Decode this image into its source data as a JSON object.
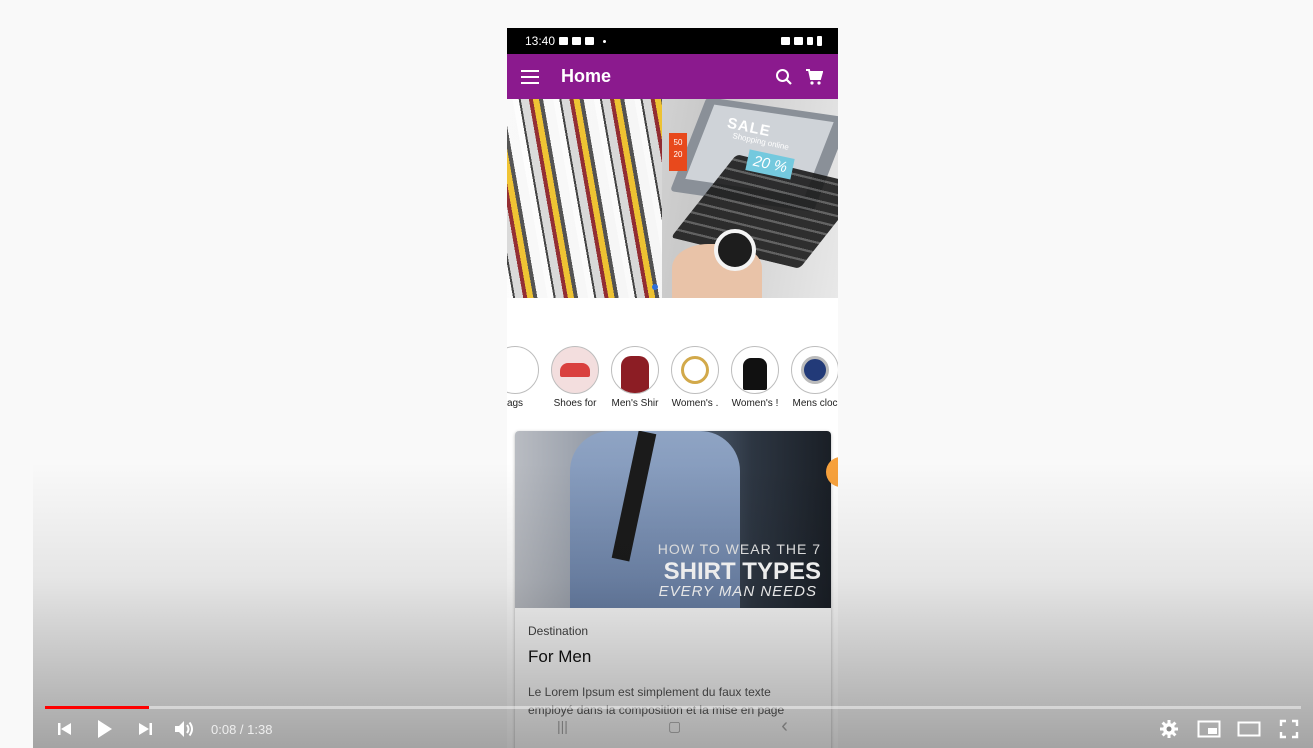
{
  "status_bar": {
    "time": "13:40"
  },
  "app_bar": {
    "title": "Home"
  },
  "banner": {
    "sale": "SALE",
    "sub": "Shopping online",
    "percent": "20 %",
    "tag": "50 20"
  },
  "categories": [
    {
      "label": "ags"
    },
    {
      "label": "Shoes for"
    },
    {
      "label": "Men's Shir"
    },
    {
      "label": "Women's ."
    },
    {
      "label": "Women's !"
    },
    {
      "label": "Mens cloc"
    }
  ],
  "card": {
    "image_line1": "HOW TO WEAR THE 7",
    "image_line2": "SHIRT TYPES",
    "image_line3": "EVERY MAN NEEDS",
    "kicker": "Destination",
    "title": "For Men",
    "description": "Le Lorem Ipsum est simplement du faux texte employé dans la composition et la mise en page"
  },
  "nav_bar": {
    "recents": "|||",
    "home": "▢",
    "back": "‹"
  },
  "player": {
    "time_display": "0:08 / 1:38",
    "progress": 0.083,
    "accent_color": "#ff0000"
  }
}
